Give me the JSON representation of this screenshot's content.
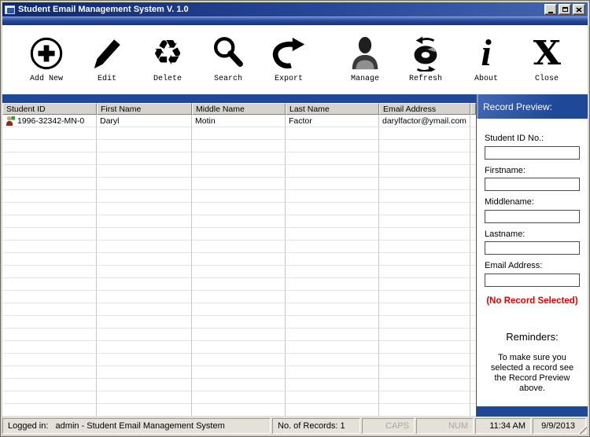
{
  "window": {
    "title": "Student Email Management System V. 1.0",
    "controls": {
      "minimize": "minimize",
      "maximize": "maximize",
      "close": "close"
    }
  },
  "toolbar": {
    "items": [
      {
        "id": "add-new",
        "label": "Add New",
        "icon": "plus-circle-icon"
      },
      {
        "id": "edit",
        "label": "Edit",
        "icon": "pencil-icon"
      },
      {
        "id": "delete",
        "label": "Delete",
        "icon": "recycle-icon",
        "glyph": "♻"
      },
      {
        "id": "search",
        "label": "Search",
        "icon": "magnifier-icon"
      },
      {
        "id": "export",
        "label": "Export",
        "icon": "curved-arrow-icon"
      },
      {
        "id": "manage",
        "label": "Manage",
        "icon": "person-icon"
      },
      {
        "id": "refresh",
        "label": "Refresh",
        "icon": "disc-arrows-icon"
      },
      {
        "id": "about",
        "label": "About",
        "icon": "info-italic-i-icon",
        "glyph": "i"
      },
      {
        "id": "close",
        "label": "Close",
        "icon": "bold-x-icon",
        "glyph": "X"
      }
    ]
  },
  "table": {
    "columns": [
      "Student ID",
      "First Name",
      "Middle Name",
      "Last Name",
      "Email Address"
    ],
    "rows": [
      {
        "student_id": "1996-32342-MN-0",
        "first_name": "Daryl",
        "middle_name": "Motin",
        "last_name": "Factor",
        "email": "darylfactor@ymail.com"
      }
    ],
    "empty_row_count": 24
  },
  "record_preview": {
    "header": "Record Preview:",
    "fields": [
      {
        "label": "Student ID No.:",
        "value": ""
      },
      {
        "label": "Firstname:",
        "value": ""
      },
      {
        "label": "Middlename:",
        "value": ""
      },
      {
        "label": "Lastname:",
        "value": ""
      },
      {
        "label": "Email Address:",
        "value": ""
      }
    ],
    "status": "(No Record Selected)",
    "reminders_title": "Reminders:",
    "reminders_text": "To make sure you selected a record see the Record Preview above."
  },
  "status_bar": {
    "logged_in": "Logged in:   admin - Student Email Management System",
    "record_count": "No. of Records: 1",
    "caps": "CAPS",
    "num": "NUM",
    "time": "11:34 AM",
    "date": "9/9/2013"
  },
  "colors": {
    "title_bar_blue": "#16337E",
    "accent_blue": "#1F4899",
    "alert_red": "#E00000",
    "chrome_gray": "#D6D3CE"
  }
}
